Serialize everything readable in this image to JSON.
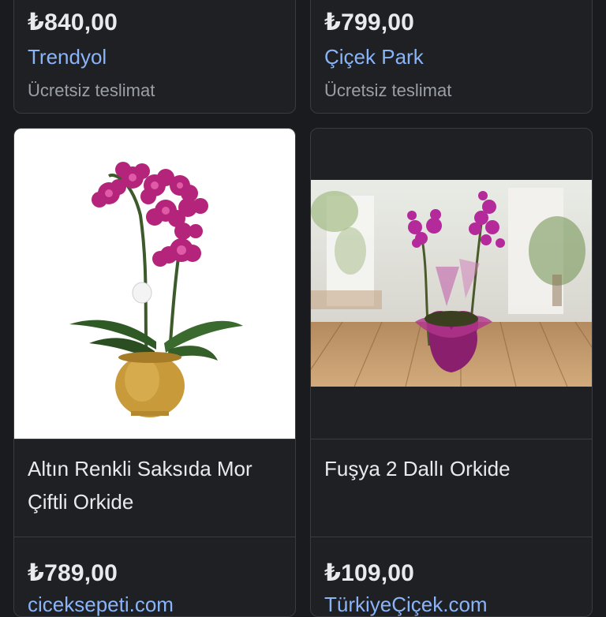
{
  "products": [
    {
      "price": "₺840,00",
      "store": "Trendyol",
      "shipping": "Ücretsiz teslimat"
    },
    {
      "price": "₺799,00",
      "store": "Çiçek Park",
      "shipping": "Ücretsiz teslimat"
    },
    {
      "title": "Altın Renkli Saksıda Mor Çiftli Orkide",
      "price": "₺789,00",
      "store": "ciceksepeti.com"
    },
    {
      "title": "Fuşya 2 Dallı Orkide",
      "price": "₺109,00",
      "store": "TürkiyeÇiçek.com"
    }
  ],
  "icons": {
    "product_image_1": "orchid-gold-pot-image",
    "product_image_2": "orchid-wood-table-image"
  },
  "colors": {
    "background": "#1a1b1e",
    "card": "#1f2023",
    "link": "#8ab4f8",
    "muted": "#9aa0a6",
    "text": "#e8eaed"
  }
}
